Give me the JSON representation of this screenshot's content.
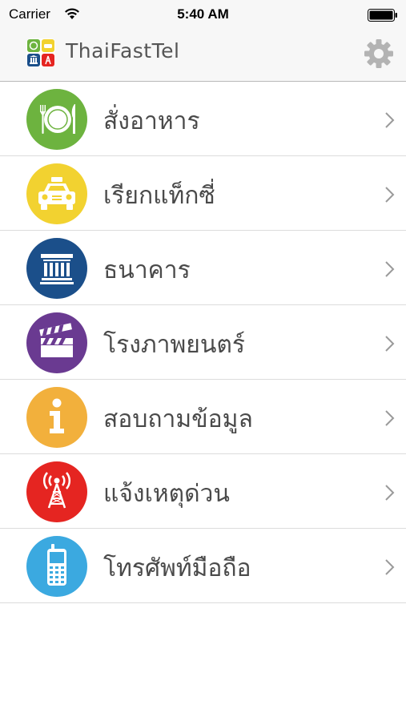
{
  "status_bar": {
    "carrier": "Carrier",
    "time": "5:40 AM"
  },
  "nav": {
    "title": "ThaiFastTel",
    "settings_icon": "gear-icon"
  },
  "menu": {
    "items": [
      {
        "label": "สั่งอาหาร",
        "icon": "food-plate-icon",
        "color": "#6db33f"
      },
      {
        "label": "เรียกแท็กซี่",
        "icon": "taxi-icon",
        "color": "#f2d230"
      },
      {
        "label": "ธนาคาร",
        "icon": "bank-icon",
        "color": "#1b4f8a"
      },
      {
        "label": "โรงภาพยนตร์",
        "icon": "clapperboard-icon",
        "color": "#6a3a91"
      },
      {
        "label": "สอบถามข้อมูล",
        "icon": "info-icon",
        "color": "#f2b03c"
      },
      {
        "label": "แจ้งเหตุด่วน",
        "icon": "radio-tower-icon",
        "color": "#e52521"
      },
      {
        "label": "โทรศัพท์มือถือ",
        "icon": "mobile-phone-icon",
        "color": "#3ba9e0"
      }
    ]
  }
}
